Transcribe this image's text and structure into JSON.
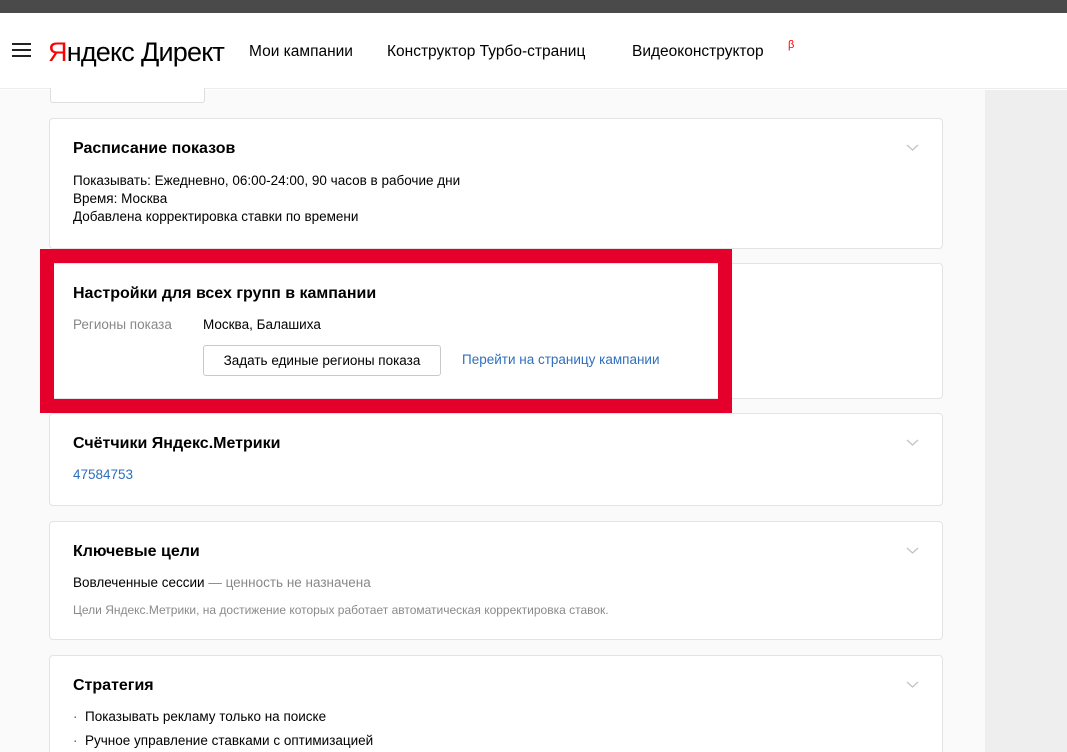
{
  "header": {
    "logo_brand_first": "Я",
    "logo_brand_rest": "ндекс",
    "logo_product": "Директ",
    "nav": [
      "Мои кампании",
      "Конструктор Турбо-страниц",
      "Видеоконструктор"
    ],
    "beta": "β"
  },
  "schedule": {
    "title": "Расписание показов",
    "line1": "Показывать: Ежедневно, 06:00-24:00, 90 часов в рабочие дни",
    "line2": "Время: Москва",
    "line3": "Добавлена корректировка ставки по времени"
  },
  "group_settings": {
    "title": "Настройки для всех групп в кампании",
    "regions_label": "Регионы показа",
    "regions_value": "Москва, Балашиха",
    "set_regions_button": "Задать единые регионы показа",
    "go_to_campaign_link": "Перейти на страницу кампании"
  },
  "metrika": {
    "title": "Счётчики Яндекс.Метрики",
    "counter": "47584753"
  },
  "goals": {
    "title": "Ключевые цели",
    "goal_name": "Вовлеченные сессии",
    "goal_value": "— ценность не назначена",
    "hint": "Цели Яндекс.Метрики, на достижение которых работает автоматическая корректировка ставок."
  },
  "strategy": {
    "title": "Стратегия",
    "items": [
      "Показывать рекламу только на поиске",
      "Ручное управление ставками с оптимизацией"
    ]
  },
  "colors": {
    "brand_red": "#f00",
    "highlight": "#e4002b",
    "link": "#2f6fbc"
  }
}
